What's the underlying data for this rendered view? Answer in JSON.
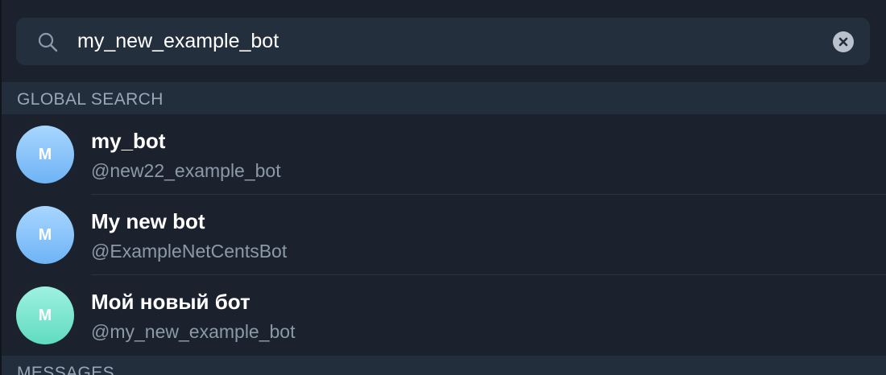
{
  "search": {
    "value": "my_new_example_bot",
    "search_icon": "search-icon",
    "clear_icon": "close-circle-icon"
  },
  "sections": {
    "global_search": "GLOBAL SEARCH",
    "messages": "MESSAGES"
  },
  "results": [
    {
      "initial": "M",
      "name": "my_bot",
      "username": "@new22_example_bot",
      "avatar_color": "#8cc5fa"
    },
    {
      "initial": "M",
      "name": "My new bot",
      "username": "@ExampleNetCentsBot",
      "avatar_color": "#8cc5fa"
    },
    {
      "initial": "M",
      "name": "Мой новый бот",
      "username": "@my_new_example_bot",
      "avatar_color": "#7fe8d3"
    }
  ],
  "colors": {
    "background": "#1b222d",
    "search_box": "#242f3e",
    "section_header": "#232e3d",
    "accent_text": "#ffffff",
    "muted_text": "#8b99a8"
  }
}
